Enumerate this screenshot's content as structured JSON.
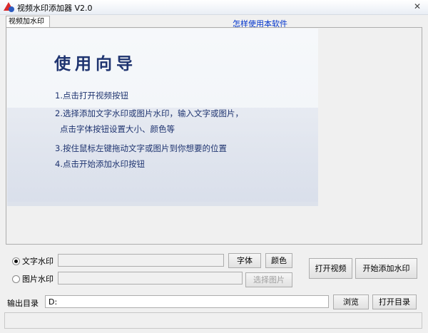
{
  "window": {
    "title": "视频水印添加器 V2.0",
    "close_glyph": "✕"
  },
  "tabs": [
    {
      "label": "视频加水印"
    }
  ],
  "help_link": "怎样使用本软件",
  "guide": {
    "title": "使用向导",
    "steps": [
      "1.点击打开视频按钮",
      "2.选择添加文字水印或图片水印，输入文字或图片，",
      "点击字体按钮设置大小、颜色等",
      "3.按住鼠标左键拖动文字或图片到你想要的位置",
      "4.点击开始添加水印按钮"
    ]
  },
  "text_watermark": {
    "label": "文字水印",
    "selected": true,
    "value": "",
    "font_button": "字体",
    "color_button": "颜色"
  },
  "image_watermark": {
    "label": "图片水印",
    "selected": false,
    "value": "",
    "choose_button": "选择图片"
  },
  "actions": {
    "open_video": "打开视频",
    "start": "开始添加水印"
  },
  "output": {
    "label": "输出目录",
    "value": "D:",
    "browse": "浏览",
    "open_dir": "打开目录"
  },
  "icons": {
    "app": "app-icon",
    "close": "close-icon"
  }
}
